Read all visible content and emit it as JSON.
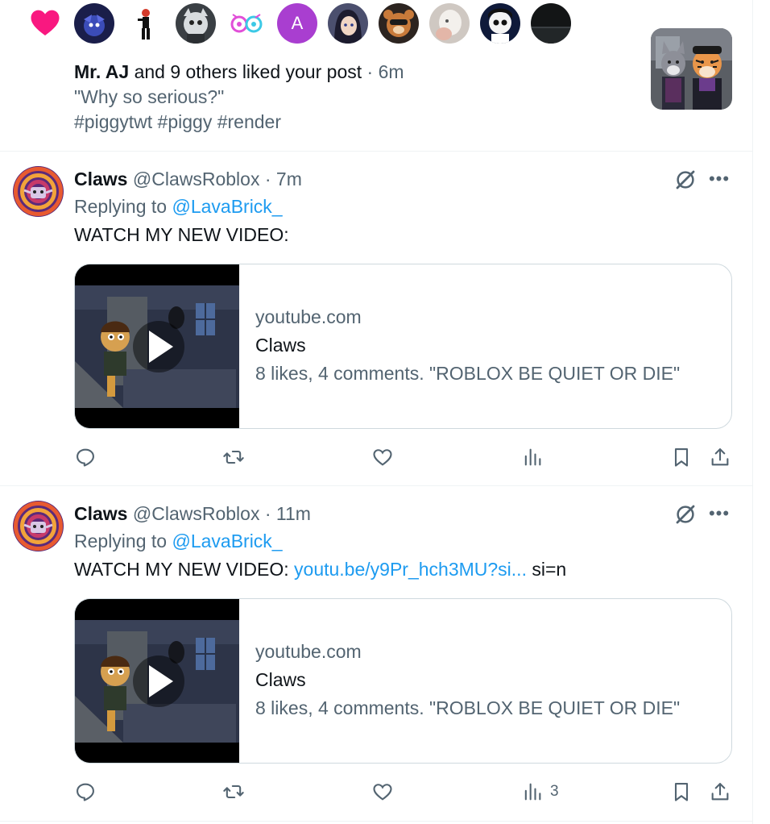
{
  "notification": {
    "actor": "Mr. AJ",
    "action": "and 9 others liked your post",
    "separator": "·",
    "time": "6m",
    "quote": "\"Why so serious?\"",
    "hashtags": "#piggytwt #piggy #render",
    "letter_avatar": "A",
    "icons": [
      "heart-icon"
    ],
    "colors": {
      "heart": "#f91880",
      "letter_avatar": "#a93ed0"
    }
  },
  "tweets": [
    {
      "name": "Claws",
      "handle": "@ClawsRoblox",
      "separator": "·",
      "time": "7m",
      "replying_label": "Replying to",
      "replying_to": "@LavaBrick_",
      "body_text": "WATCH MY NEW VIDEO:",
      "body_link": "",
      "body_suffix": "",
      "card": {
        "domain": "youtube.com",
        "title": "Claws",
        "description": "8 likes, 4 comments. \"ROBLOX BE QUIET OR DIE\""
      },
      "views": ""
    },
    {
      "name": "Claws",
      "handle": "@ClawsRoblox",
      "separator": "·",
      "time": "11m",
      "replying_label": "Replying to",
      "replying_to": "@LavaBrick_",
      "body_text": "WATCH MY NEW VIDEO: ",
      "body_link": "youtu.be/y9Pr_hch3MU?si...",
      "body_suffix": " si=n",
      "card": {
        "domain": "youtube.com",
        "title": "Claws",
        "description": "8 likes, 4 comments. \"ROBLOX BE QUIET OR DIE\""
      },
      "views": "3"
    }
  ],
  "actions_icons": [
    "reply-icon",
    "retweet-icon",
    "like-icon",
    "views-icon",
    "bookmark-icon",
    "share-icon"
  ],
  "theme": {
    "link": "#1d9bf0",
    "secondary_text": "#536471",
    "border": "#cfd9de"
  }
}
